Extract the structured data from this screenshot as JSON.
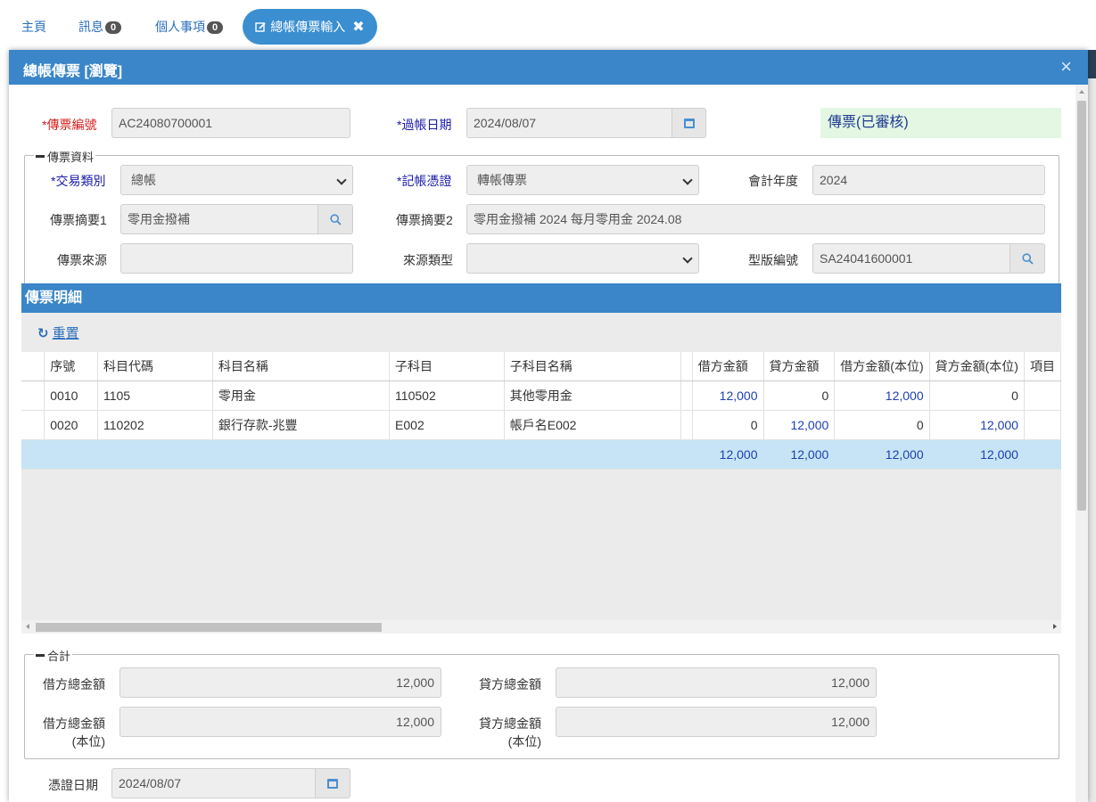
{
  "tabs": {
    "home": "主頁",
    "messages": "訊息",
    "messages_count": "0",
    "personal": "個人事項",
    "personal_count": "0",
    "active": "總帳傳票輸入",
    "active_close": "✖"
  },
  "modal": {
    "title": "總帳傳票 [瀏覽]",
    "close": "×"
  },
  "header_fields": {
    "voucher_no_label": "*傳票編號",
    "voucher_no": "AC24080700001",
    "post_date_label": "*過帳日期",
    "post_date": "2024/08/07",
    "status": "傳票(已審核)"
  },
  "voucher_info": {
    "legend": "傳票資料",
    "trade_type_label": "*交易類別",
    "trade_type": "總帳",
    "proof_label": "*記帳憑證",
    "proof": "轉帳傳票",
    "fiscal_year_label": "會計年度",
    "fiscal_year": "2024",
    "summary1_label": "傳票摘要1",
    "summary1": "零用金撥補",
    "summary2_label": "傳票摘要2",
    "summary2": "零用金撥補 2024 每月零用金 2024.08",
    "source_label": "傳票來源",
    "source": "",
    "source_type_label": "來源類型",
    "source_type": "",
    "template_label": "型版編號",
    "template": "SA24041600001"
  },
  "detail": {
    "title": "傳票明細",
    "reset": "重置",
    "columns": [
      "序號",
      "科目代碼",
      "科目名稱",
      "子科目",
      "子科目名稱",
      "借方金額",
      "貸方金額",
      "借方金額(本位)",
      "貸方金額(本位)",
      "項目"
    ],
    "rows": [
      {
        "seq": "0010",
        "code": "1105",
        "name": "零用金",
        "sub": "110502",
        "sub_name": "其他零用金",
        "debit": "12,000",
        "credit": "0",
        "debit_base": "12,000",
        "credit_base": "0"
      },
      {
        "seq": "0020",
        "code": "110202",
        "name": "銀行存款-兆豐",
        "sub": "E002",
        "sub_name": "帳戶名E002",
        "debit": "0",
        "credit": "12,000",
        "debit_base": "0",
        "credit_base": "12,000"
      }
    ],
    "totals": {
      "debit": "12,000",
      "credit": "12,000",
      "debit_base": "12,000",
      "credit_base": "12,000"
    }
  },
  "summary": {
    "legend": "合計",
    "debit_total_label": "借方總金額",
    "debit_total": "12,000",
    "credit_total_label": "貸方總金額",
    "credit_total": "12,000",
    "debit_total_base_label_1": "借方總金額",
    "debit_total_base_label_2": "(本位)",
    "debit_total_base": "12,000",
    "credit_total_base_label_1": "貸方總金額",
    "credit_total_base_label_2": "(本位)",
    "credit_total_base": "12,000"
  },
  "footer": {
    "proof_date_label": "憑證日期",
    "proof_date": "2024/08/07"
  },
  "icons": {
    "search": "search-icon",
    "calendar": "calendar-icon",
    "refresh": "refresh-icon",
    "edit": "edit-icon"
  },
  "colors": {
    "header_blue": "#3a86c8",
    "required_blue": "#1a1aa8",
    "required_red": "#d42020",
    "status_bg": "#e3f7e3",
    "total_row": "#c6e4f5"
  }
}
